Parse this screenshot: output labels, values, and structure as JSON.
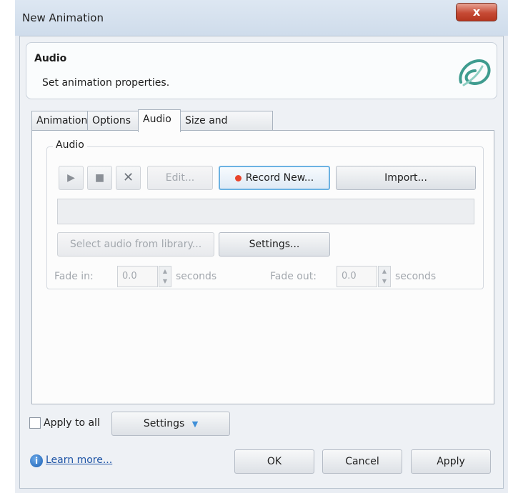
{
  "window": {
    "title": "New Animation",
    "close_glyph": "x"
  },
  "header": {
    "title": "Audio",
    "subtitle": "Set animation properties.",
    "logo_icon": "app-logo-icon"
  },
  "tabs": [
    {
      "label": "Animation"
    },
    {
      "label": "Options"
    },
    {
      "label": "Audio",
      "active": true
    },
    {
      "label": "Size and Position"
    }
  ],
  "audio_group": {
    "legend": "Audio",
    "play_glyph": "▶",
    "stop_glyph": "■",
    "delete_glyph": "✕",
    "edit_label": "Edit...",
    "record_label": "Record New...",
    "import_label": "Import...",
    "library_label": "Select audio from library...",
    "settings_label": "Settings...",
    "fade_in_label": "Fade in:",
    "fade_in_value": "0.0",
    "fade_out_label": "Fade out:",
    "fade_out_value": "0.0",
    "seconds_label": "seconds"
  },
  "footer": {
    "apply_to_all_label": "Apply to all",
    "apply_to_all_checked": false,
    "settings_label": "Settings",
    "learn_more_label": "Learn more...",
    "ok_label": "OK",
    "cancel_label": "Cancel",
    "apply_label": "Apply"
  },
  "colors": {
    "accent": "#6cb2e2",
    "record_dot": "#e8442c",
    "link": "#1f55a6"
  }
}
